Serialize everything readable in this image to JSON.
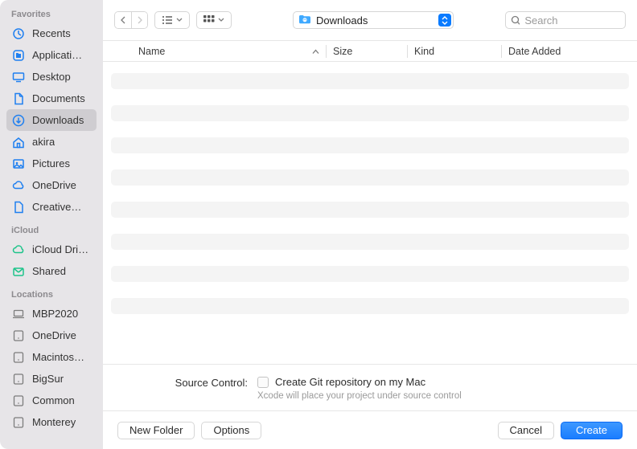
{
  "sidebar": {
    "sections": [
      {
        "title": "Favorites",
        "items": [
          {
            "id": "recents",
            "label": "Recents",
            "icon": "clock"
          },
          {
            "id": "applications",
            "label": "Applicati…",
            "icon": "app"
          },
          {
            "id": "desktop",
            "label": "Desktop",
            "icon": "desktop"
          },
          {
            "id": "documents",
            "label": "Documents",
            "icon": "doc"
          },
          {
            "id": "downloads",
            "label": "Downloads",
            "icon": "download",
            "selected": true
          },
          {
            "id": "akira",
            "label": "akira",
            "icon": "home"
          },
          {
            "id": "pictures",
            "label": "Pictures",
            "icon": "pictures"
          },
          {
            "id": "onedrive",
            "label": "OneDrive",
            "icon": "cloud"
          },
          {
            "id": "creative",
            "label": "Creative…",
            "icon": "file"
          }
        ]
      },
      {
        "title": "iCloud",
        "items": [
          {
            "id": "icloud",
            "label": "iCloud Dri…",
            "icon": "cloud-green"
          },
          {
            "id": "shared",
            "label": "Shared",
            "icon": "shared-green"
          }
        ]
      },
      {
        "title": "Locations",
        "items": [
          {
            "id": "mbp2020",
            "label": "MBP2020",
            "icon": "laptop"
          },
          {
            "id": "onedrive-loc",
            "label": "OneDrive",
            "icon": "disk"
          },
          {
            "id": "macintosh",
            "label": "Macintos…",
            "icon": "disk"
          },
          {
            "id": "bigsur",
            "label": "BigSur",
            "icon": "disk"
          },
          {
            "id": "common",
            "label": "Common",
            "icon": "disk"
          },
          {
            "id": "monterey",
            "label": "Monterey",
            "icon": "disk"
          }
        ]
      }
    ]
  },
  "toolbar": {
    "current_location": "Downloads",
    "search_placeholder": "Search"
  },
  "headers": {
    "name": "Name",
    "size": "Size",
    "kind": "Kind",
    "date_added": "Date Added",
    "sort_column": "name",
    "sort_dir": "asc"
  },
  "file_rows": [
    0,
    1,
    2,
    3,
    4,
    5,
    6,
    7
  ],
  "source_control": {
    "label": "Source Control:",
    "checkbox_label": "Create Git repository on my Mac",
    "note": "Xcode will place your project under source control",
    "checked": false
  },
  "footer": {
    "new_folder": "New Folder",
    "options": "Options",
    "cancel": "Cancel",
    "create": "Create"
  },
  "colors": {
    "accent": "#0a7bff",
    "sidebar_bg": "#e7e5e8",
    "icon_blue": "#1e7ff0",
    "icon_green": "#1ec48a"
  }
}
